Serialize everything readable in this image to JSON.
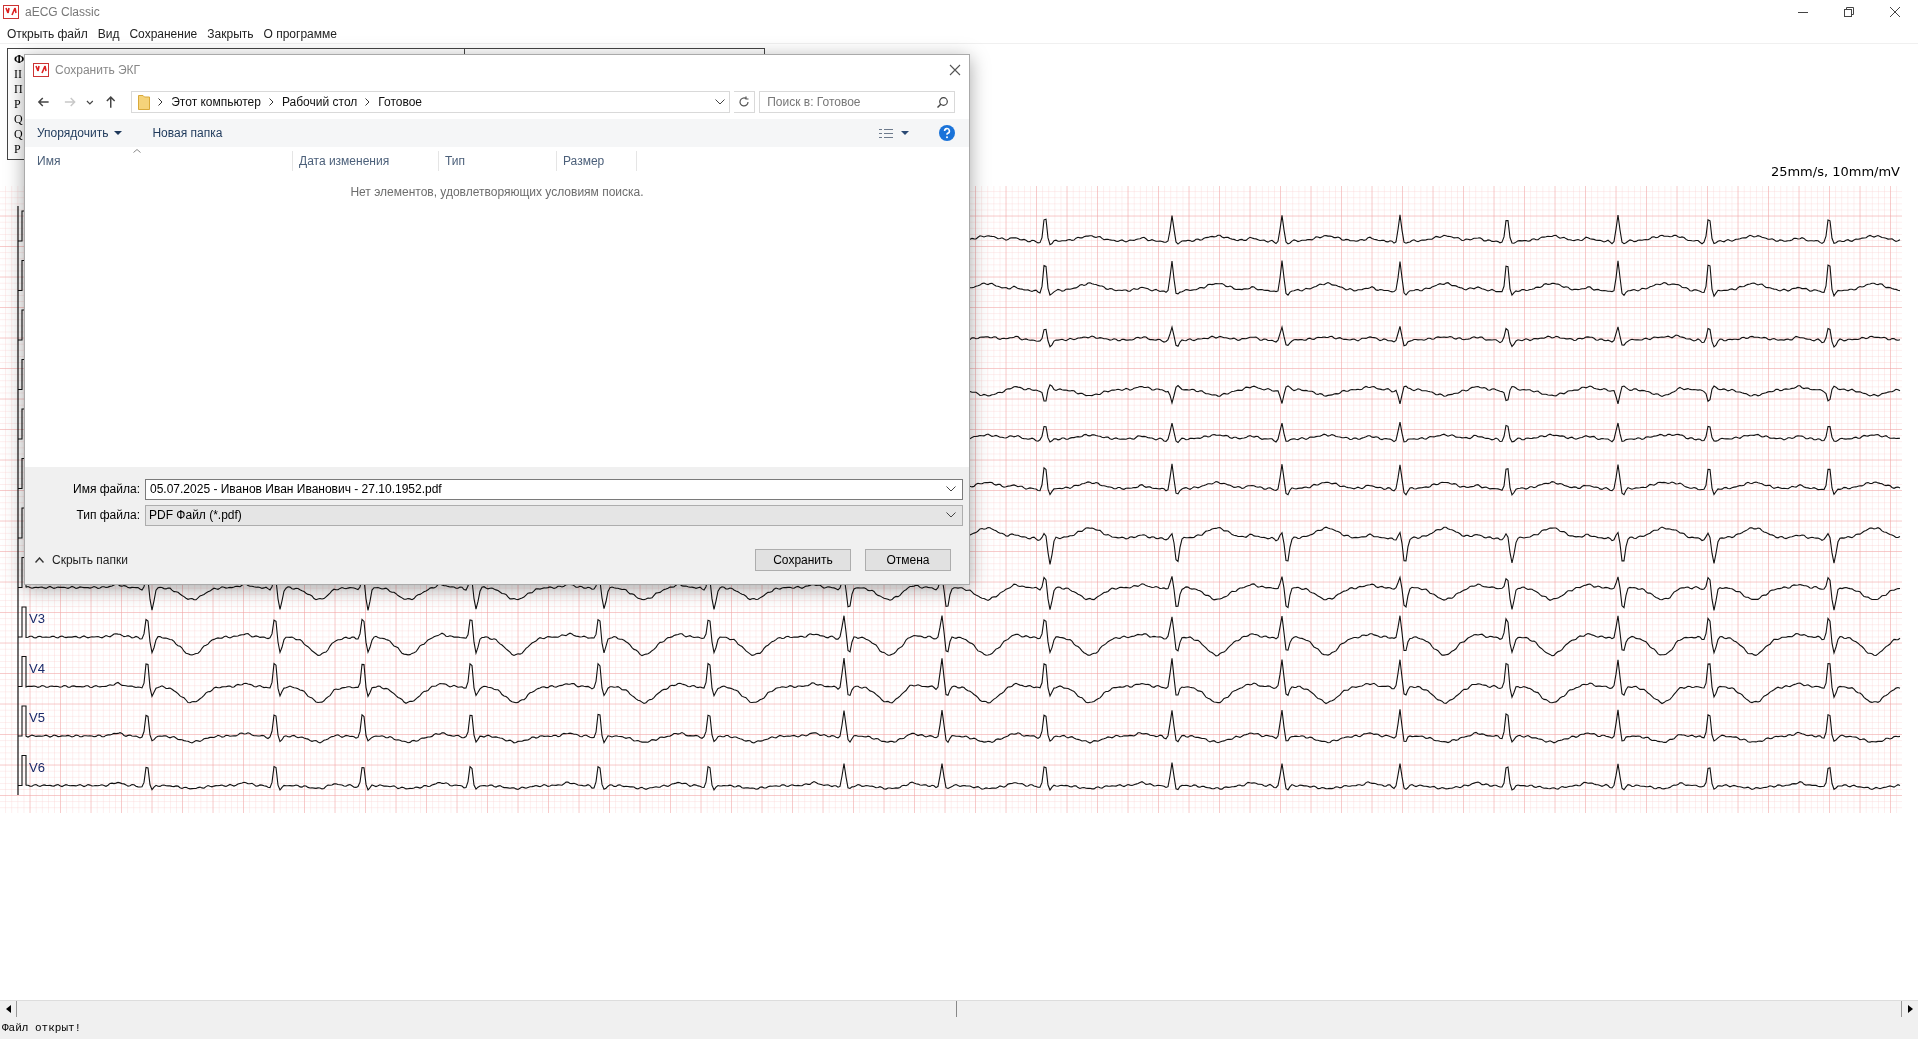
{
  "window": {
    "title": "aECG Classic"
  },
  "menu": [
    "Открыть файл",
    "Вид",
    "Сохранение",
    "Закрыть",
    "О программе"
  ],
  "info_panel": {
    "lines": [
      "Ф",
      "II",
      "П",
      "P",
      "Q",
      "Q",
      "P"
    ]
  },
  "ecg": {
    "scale": "25mm/s, 10mm/mV",
    "lead_labels": [
      "V3",
      "V4",
      "V5",
      "V6"
    ]
  },
  "dialog": {
    "title": "Сохранить ЭКГ",
    "nav": [
      {
        "kind": "back",
        "disabled": false
      },
      {
        "kind": "forward",
        "disabled": true
      },
      {
        "kind": "recent",
        "disabled": false
      },
      {
        "kind": "up",
        "disabled": false
      }
    ],
    "breadcrumb": [
      "Этот компьютер",
      "Рабочий стол",
      "Готовое"
    ],
    "search": {
      "placeholder": "Поиск в: Готовое"
    },
    "toolbar": [
      "Упорядочить",
      "Новая папка"
    ],
    "columns": [
      "Имя",
      "Дата изменения",
      "Тип",
      "Размер"
    ],
    "empty_message": "Нет элементов, удовлетворяющих условиям поиска.",
    "filename": {
      "label": "Имя файла:",
      "value": "05.07.2025 - Иванов Иван Иванович - 27.10.1952.pdf"
    },
    "filetype": {
      "label": "Тип файла:",
      "value": "PDF Файл (*.pdf)"
    },
    "hide_folders": "Скрыть папки",
    "buttons": [
      "Сохранить",
      "Отмена"
    ]
  },
  "status_bar": "Файл открыт!"
}
